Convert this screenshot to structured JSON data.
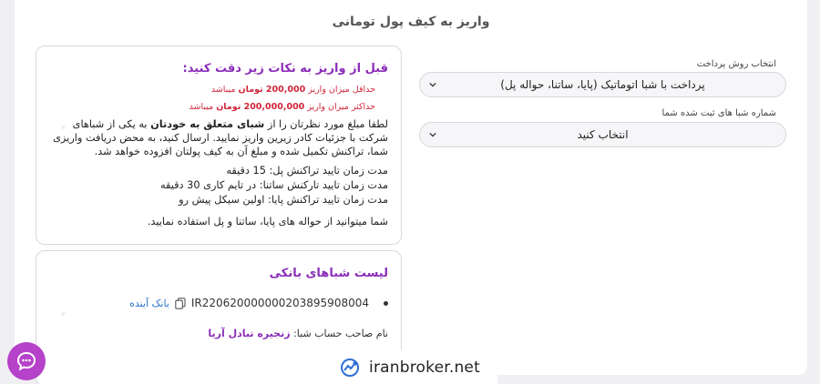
{
  "page": {
    "title": "واریز به کیف پول تومانی"
  },
  "form": {
    "method_label": "انتخاب روش پرداخت",
    "method_value": "پرداخت با شبا اتوماتیک (پایا، ساتنا، حواله پل)",
    "sheba_label": "شماره شبا های ثبت شده شما",
    "sheba_value": "انتخاب کنید"
  },
  "notice": {
    "title": "قبل از واریز به نکات زیر دقت کنید:",
    "min_pre": "حداقل میزان واریز ",
    "min_amount": "200,000 تومان",
    "min_post": " میباشد",
    "max_pre": "حداکثر میزان واریز ",
    "max_amount": "200,000,000 تومان",
    "max_post": " میباشد",
    "p1_a": "لطفا مبلغ مورد نظرتان را از ",
    "p1_b": "شبای متعلق به خودتان",
    "p1_c": " به یکی از شباهای شرکت با جزئیات کادر زیرین واریز نمایید. ارسال کنید، به محض دریافت واریزی شما، تراکنش تکمیل شده و مبلغ آن به کیف پولتان افزوده خواهد شد.",
    "t1": "مدت زمان تایید تراکنش پل: 15 دقیقه",
    "t2": "مدت زمان تایید تارکنش ساتنا: در تایم کاری 30 دقیقه",
    "t3": "مدت زمان تایید تراکنش پایا: اولین سیکل پیش رو",
    "t4": "شما میتوانید از حواله های پایا، ساتنا و پل استفاده نمایید."
  },
  "banks": {
    "title": "لیست شباهای بانکی",
    "iban": "IR220620000000203895908004",
    "bank_name": "بانک آینده",
    "owner_label": "نام صاحب حساب شبا: ",
    "owner_name": "زنجیره تبادل آریا"
  },
  "brand": {
    "name": "iranbroker.net"
  },
  "icons": [
    "chevron-down-icon",
    "copy-icon",
    "chat-icon",
    "brand-logo-icon"
  ],
  "colors": {
    "accent": "#8a2db8",
    "warning": "#d0263b",
    "link": "#2a74c9",
    "chat": "#b542c9"
  }
}
